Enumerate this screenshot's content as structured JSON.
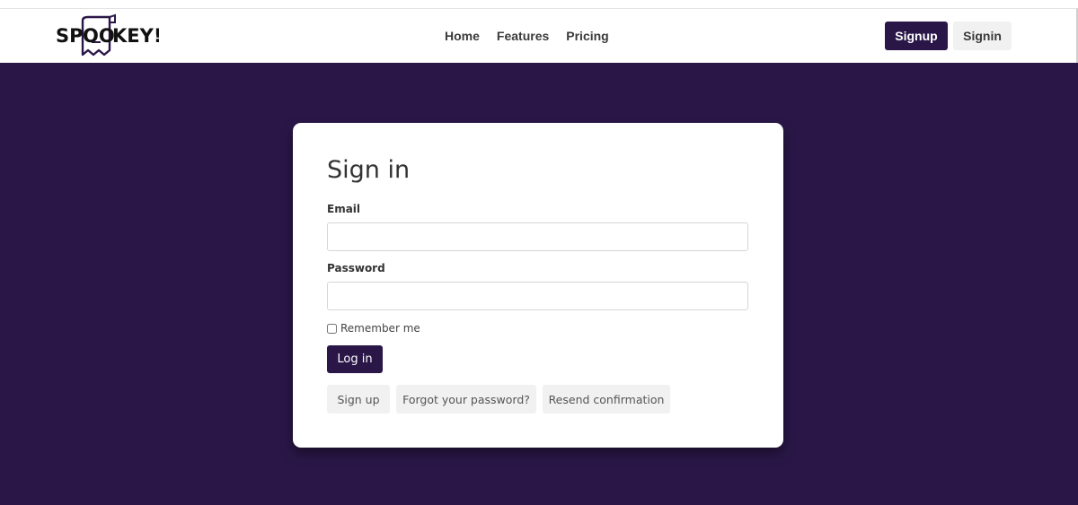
{
  "brand": {
    "logo_text": "SPOOKEY!"
  },
  "navbar": {
    "links": [
      "Home",
      "Features",
      "Pricing"
    ],
    "signup_label": "Signup",
    "signin_label": "Signin"
  },
  "form": {
    "title": "Sign in",
    "email_label": "Email",
    "email_value": "",
    "password_label": "Password",
    "password_value": "",
    "remember_label": "Remember me",
    "remember_checked": false,
    "submit_label": "Log in",
    "links": [
      "Sign up",
      "Forgot your password?",
      "Resend confirmation"
    ]
  },
  "colors": {
    "brand": "#2a1748",
    "page_background": "#2a1748",
    "secondary_button": "#f1f1f1"
  }
}
